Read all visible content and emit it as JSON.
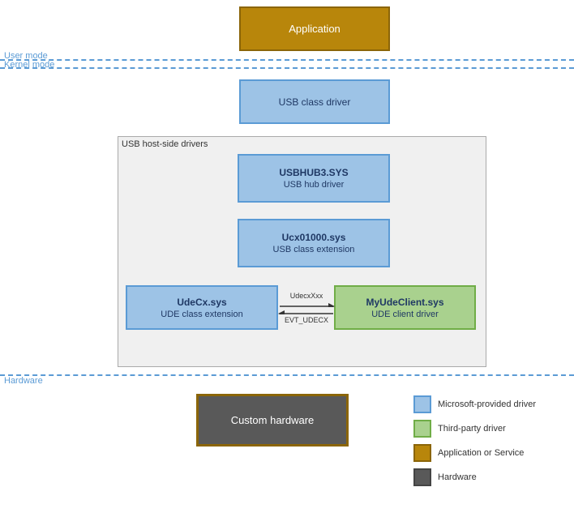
{
  "diagram": {
    "application": {
      "label": "Application"
    },
    "userMode": {
      "label": "User mode"
    },
    "kernelMode": {
      "label": "Kernel mode"
    },
    "usbClassDriver": {
      "label": "USB class driver"
    },
    "hostDriversGroup": {
      "label": "USB host-side drivers"
    },
    "usbhub": {
      "title": "USBHUB3.SYS",
      "subtitle": "USB hub driver"
    },
    "ucx": {
      "title": "Ucx01000.sys",
      "subtitle": "USB class extension"
    },
    "udecx": {
      "title": "UdeCx.sys",
      "subtitle": "UDE class extension"
    },
    "myude": {
      "title": "MyUdeClient.sys",
      "subtitle": "UDE client driver"
    },
    "arrowLabels": {
      "top": "UdecxXxx",
      "bottom": "EVT_UDECX"
    },
    "hardware": {
      "label": "Hardware"
    },
    "customHardware": {
      "label": "Custom hardware"
    },
    "legend": {
      "items": [
        {
          "color": "#9dc3e6",
          "borderColor": "#5b9bd5",
          "text": "Microsoft-provided driver"
        },
        {
          "color": "#a9d18e",
          "borderColor": "#70ad47",
          "text": "Third-party driver"
        },
        {
          "color": "#b8860b",
          "borderColor": "#8b6508",
          "text": "Application or Service"
        },
        {
          "color": "#595959",
          "borderColor": "#444",
          "text": "Hardware"
        }
      ]
    }
  }
}
